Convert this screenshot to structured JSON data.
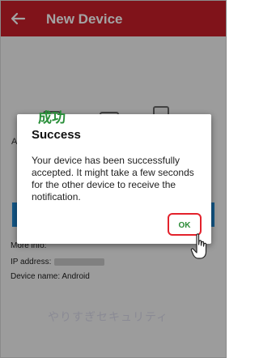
{
  "app": {
    "title": "New Device"
  },
  "background": {
    "letter": "A",
    "more_info": "More info:",
    "ip_label": "IP address:",
    "device_name": "Device name: Android",
    "watermark": "やりすぎセキュリティ"
  },
  "dialog": {
    "title": "Success",
    "message": "Your device has been successfully accepted. It might take a few seconds for the other device to receive the notification.",
    "ok_label": "OK"
  },
  "annotation": {
    "text": "成功"
  },
  "colors": {
    "appbar": "#c81e2a",
    "ok_text": "#2a8a35",
    "highlight": "#e3222c",
    "annotation": "#2a8f3a"
  },
  "icons": {
    "back": "arrow-back-icon",
    "cursor": "hand-cursor-icon"
  }
}
